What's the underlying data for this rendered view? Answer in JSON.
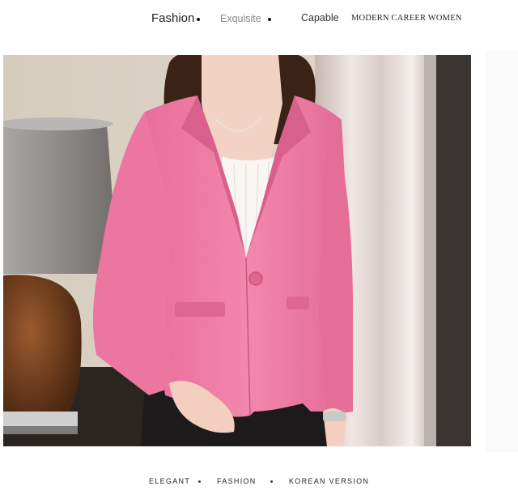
{
  "header": {
    "words": [
      "Fashion",
      "Exquisite",
      "Capable",
      "MODERN CAREER WOMEN"
    ]
  },
  "photo": {
    "subject": "woman-in-pink-blazer"
  },
  "footer": {
    "words": [
      "ELEGANT",
      "FASHION",
      "KOREAN VERSION"
    ]
  },
  "colors": {
    "blazer": "#f07fa6",
    "blazer_shadow": "#d8628c",
    "wall": "#d9cfc2",
    "curtain": "#efe8e6",
    "lamp_base": "#6b3a1e",
    "lamp_shade": "#8f8c8a"
  }
}
